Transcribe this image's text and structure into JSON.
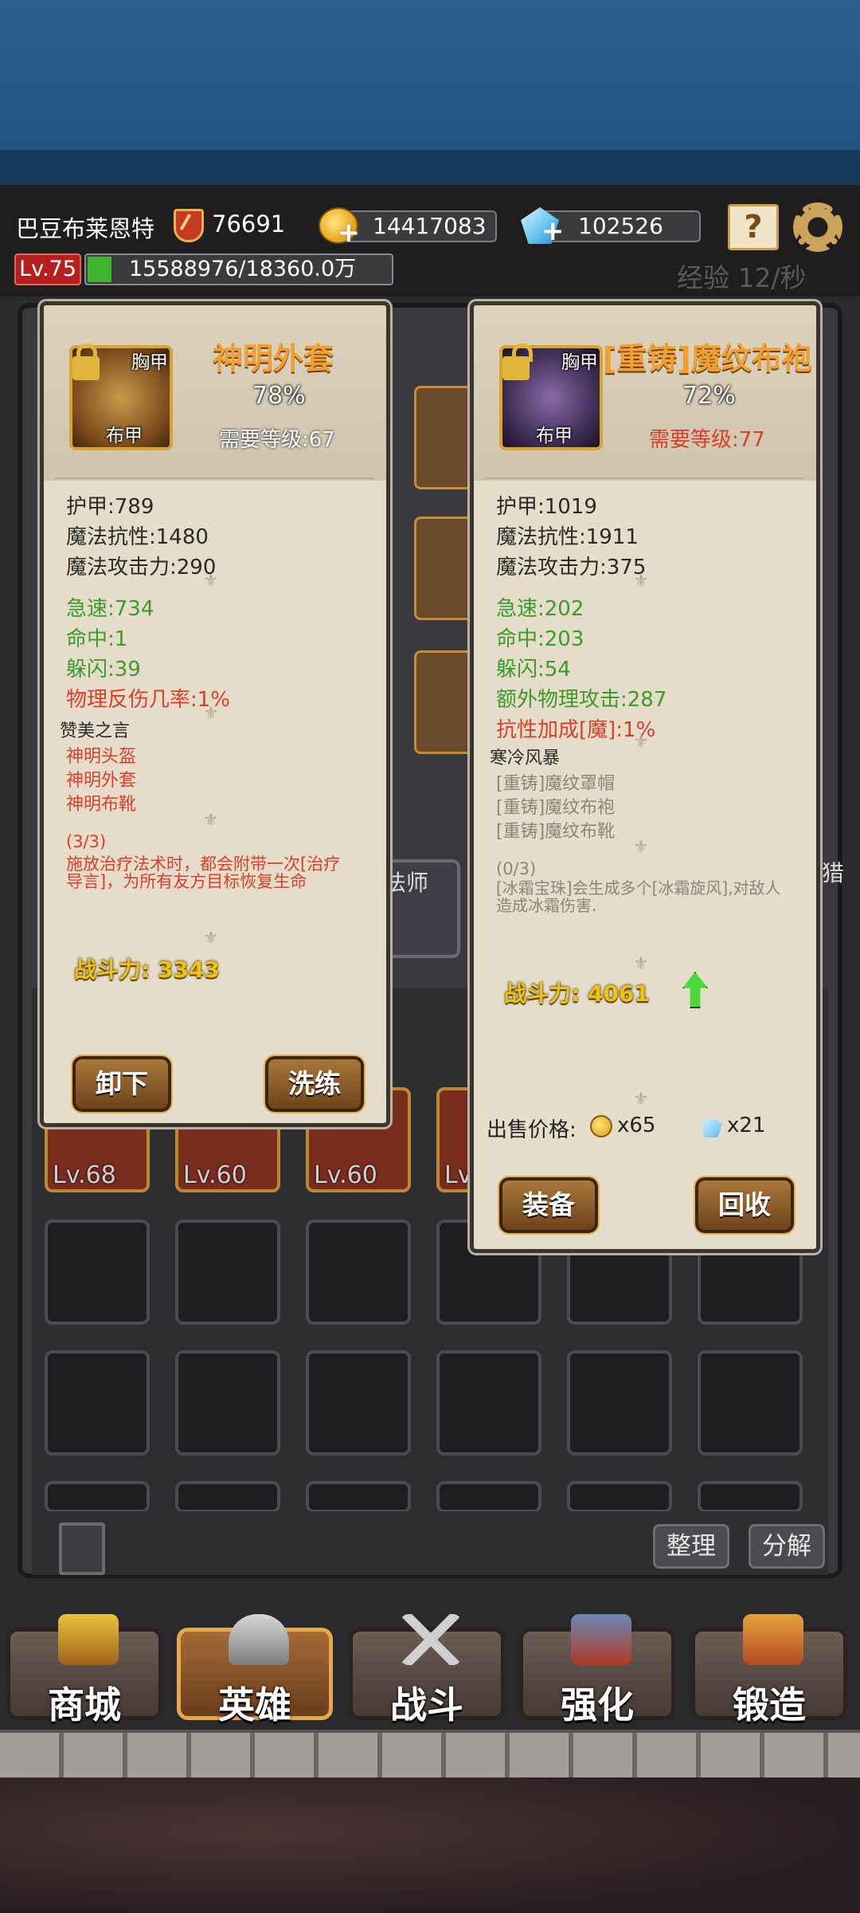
{
  "header": {
    "player_name": "巴豆布莱恩特",
    "combat_power": "76691",
    "gold": "14417083",
    "gems": "102526",
    "level": "Lv.75",
    "experience": "15588976/18360.0万",
    "experience_progress": 0.08,
    "exp_rate": "经验 12/秒"
  },
  "left_card": {
    "slot_type": "胸甲",
    "armor_type": "布甲",
    "name": "神明外套",
    "quality": "78%",
    "required_level": "需要等级:67",
    "base_stats": [
      "护甲:789",
      "魔法抗性:1480",
      "魔法攻击力:290"
    ],
    "bonus_stats": [
      "急速:734",
      "命中:1",
      "躲闪:39"
    ],
    "special_stat": "物理反伤几率:1%",
    "set_name": "赞美之言",
    "set_items": [
      "神明头盔",
      "神明外套",
      "神明布靴"
    ],
    "set_progress": "(3/3)",
    "set_effect_line1": "施放治疗法术时，都会附带一次[治疗",
    "set_effect_line2": "导言]，为所有友方目标恢复生命",
    "power": "战斗力: 3343",
    "btn_unequip": "卸下",
    "btn_reforge": "洗练"
  },
  "right_card": {
    "slot_type": "胸甲",
    "armor_type": "布甲",
    "name": "[重铸]魔纹布袍",
    "quality": "72%",
    "required_level": "需要等级:77",
    "base_stats": [
      "护甲:1019",
      "魔法抗性:1911",
      "魔法攻击力:375"
    ],
    "bonus_stats": [
      "急速:202",
      "命中:203",
      "躲闪:54",
      "额外物理攻击:287"
    ],
    "special_stat": "抗性加成[魔]:1%",
    "set_name": "寒冷风暴",
    "set_items": [
      "[重铸]魔纹罩帽",
      "[重铸]魔纹布袍",
      "[重铸]魔纹布靴"
    ],
    "set_progress": "(0/3)",
    "set_effect_line1": "[冰霜宝珠]会生成多个[冰霜旋风],对敌人",
    "set_effect_line2": "造成冰霜伤害.",
    "power": "战斗力: 4061",
    "sell_label": "出售价格:",
    "sell_gold": "x65",
    "sell_gems": "x21",
    "btn_equip": "装备",
    "btn_recycle": "回收"
  },
  "background": {
    "partial_label": "法师",
    "partial_label2": "猎",
    "slot_levels": [
      "Lv.68",
      "Lv.60",
      "Lv.60",
      "Lv"
    ]
  },
  "inventory": {
    "btn_sort": "整理",
    "btn_decompose": "分解"
  },
  "nav": {
    "shop": "商城",
    "hero": "英雄",
    "battle": "战斗",
    "enhance": "强化",
    "forge": "锻造"
  },
  "colors": {
    "accent_gold": "#f0a030",
    "stat_green": "#3c9b2c",
    "stat_red": "#d7402a",
    "power_yellow": "#f2c20b"
  }
}
